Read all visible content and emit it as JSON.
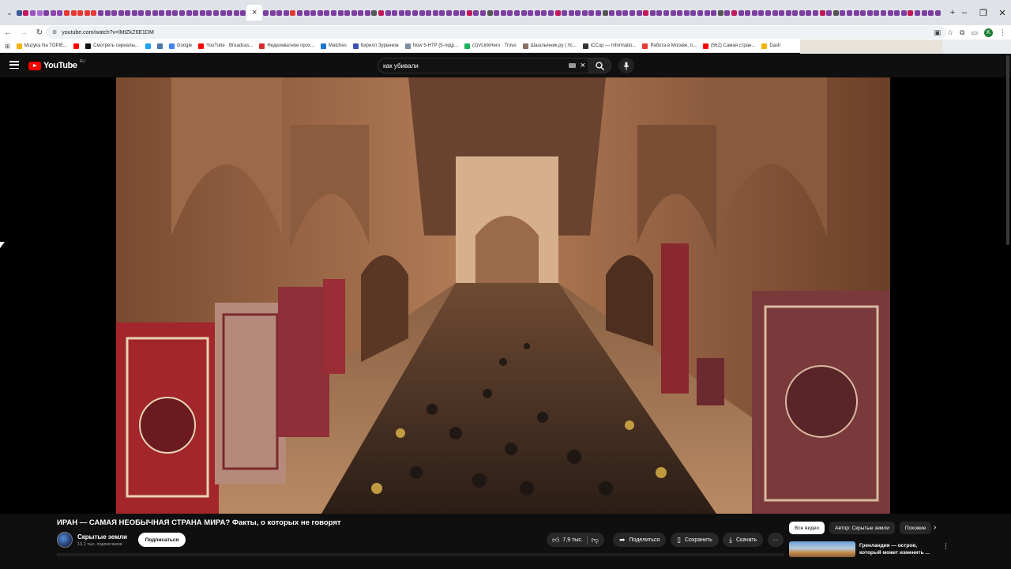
{
  "browser": {
    "url": "youtube.com/watch?v=lMtZkZ6E1DM",
    "tab_close": "×",
    "new_tab": "+",
    "window_controls": [
      "–",
      "❐",
      "✕"
    ]
  },
  "bookmarks": [
    {
      "label": "Muzyka Na TOPIE...",
      "color": "#f4b400"
    },
    {
      "label": "",
      "color": "#ff0000"
    },
    {
      "label": "Смотреть сериалы...",
      "color": "#111111"
    },
    {
      "label": "",
      "color": "#1da1f2"
    },
    {
      "label": "",
      "color": "#4a76a8"
    },
    {
      "label": "Google",
      "color": "#4285f4"
    },
    {
      "label": "YouTube · Broadcas...",
      "color": "#ff0000"
    },
    {
      "label": "Неделеватное прох...",
      "color": "#d32f2f"
    },
    {
      "label": "Matches",
      "color": "#1976d2"
    },
    {
      "label": "Кирилл Зуренков",
      "color": "#3f51b5"
    },
    {
      "label": "Now 5-HTP (5-гидр...",
      "color": "#7b8fa3"
    },
    {
      "label": "(1)VLinkHero · Trovo",
      "color": "#19b35c"
    },
    {
      "label": "Шашлычник.ру | Ус...",
      "color": "#8d6e63"
    },
    {
      "label": "iCCup — Informatio...",
      "color": "#333333"
    },
    {
      "label": "Работа в Москве, п...",
      "color": "#e53935"
    },
    {
      "label": "(562) Самая стран...",
      "color": "#ff0000"
    },
    {
      "label": "Dash",
      "color": "#f4b400"
    }
  ],
  "youtube": {
    "logo_text": "YouTube",
    "region": "RU",
    "search_query": "как убивали",
    "video_title": "ИРАН — САМАЯ НЕОБЫЧНАЯ СТРАНА МИРА? Факты, о которых не говорят",
    "channel_name": "Скрытые земли",
    "subscribers": "13,1 тыс. подписчиков",
    "subscribe_label": "Подписаться",
    "likes": "7,9 тыс.",
    "share_label": "Поделиться",
    "save_label": "Сохранить",
    "download_label": "Скачать",
    "more_label": "···",
    "watermark_glyph": "?",
    "chips": [
      "Все видео",
      "Автор: Скрытые земли",
      "Похожие"
    ],
    "recommendation_title": "Гренландия — остров, который может изменить ..."
  },
  "colors": {
    "yt_red": "#ff0000",
    "background": "#0f0f0f",
    "pill": "#272727"
  }
}
